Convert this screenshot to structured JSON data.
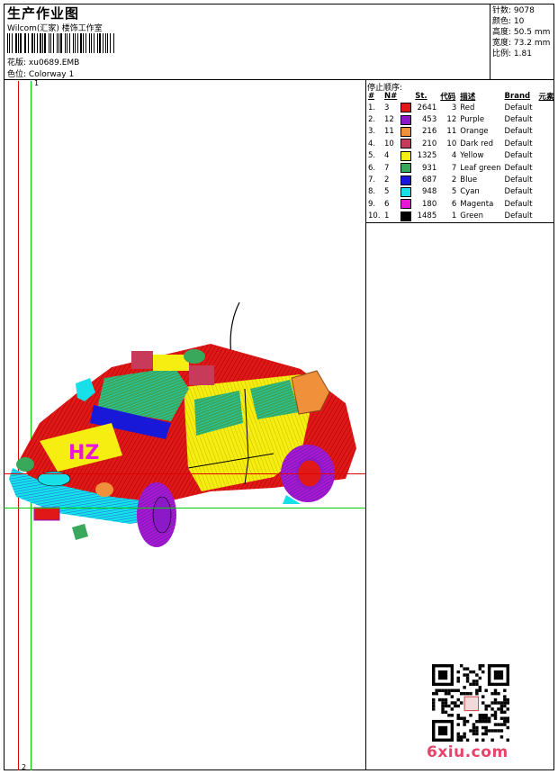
{
  "header": {
    "title": "生产作业图",
    "company": "Wilcom(汇家) 楼饰工作室",
    "design_label": "花版:",
    "design_value": "xu0689.EMB",
    "colorway_label": "色位:",
    "colorway_value": "Colorway 1"
  },
  "stats": [
    {
      "label": "针数:",
      "value": "9078"
    },
    {
      "label": "颜色:",
      "value": "10"
    },
    {
      "label": "高度:",
      "value": "50.5 mm"
    },
    {
      "label": "宽度:",
      "value": "73.2 mm"
    },
    {
      "label": "比例:",
      "value": "1.81"
    }
  ],
  "stop_sequence": {
    "title": "停止顺序:",
    "headers": {
      "order": "#",
      "needle": "N#",
      "stitches": "St.",
      "code": "代码",
      "desc": "描述",
      "brand": "Brand",
      "element": "元素"
    },
    "rows": [
      {
        "order": "1.",
        "needle": "3",
        "color": "#e01818",
        "stitches": "2641",
        "code": "3",
        "desc": "Red",
        "brand": "Default"
      },
      {
        "order": "2.",
        "needle": "12",
        "color": "#8b19c8",
        "stitches": "453",
        "code": "12",
        "desc": "Purple",
        "brand": "Default"
      },
      {
        "order": "3.",
        "needle": "11",
        "color": "#f0903a",
        "stitches": "216",
        "code": "11",
        "desc": "Orange",
        "brand": "Default"
      },
      {
        "order": "4.",
        "needle": "10",
        "color": "#c83a5a",
        "stitches": "210",
        "code": "10",
        "desc": "Dark red",
        "brand": "Default"
      },
      {
        "order": "5.",
        "needle": "4",
        "color": "#f5ee10",
        "stitches": "1325",
        "code": "4",
        "desc": "Yellow",
        "brand": "Default"
      },
      {
        "order": "6.",
        "needle": "7",
        "color": "#3aa85a",
        "stitches": "931",
        "code": "7",
        "desc": "Leaf green",
        "brand": "Default"
      },
      {
        "order": "7.",
        "needle": "2",
        "color": "#1818d8",
        "stitches": "687",
        "code": "2",
        "desc": "Blue",
        "brand": "Default"
      },
      {
        "order": "8.",
        "needle": "5",
        "color": "#18e0e8",
        "stitches": "948",
        "code": "5",
        "desc": "Cyan",
        "brand": "Default"
      },
      {
        "order": "9.",
        "needle": "6",
        "color": "#e818d8",
        "stitches": "180",
        "code": "6",
        "desc": "Magenta",
        "brand": "Default"
      },
      {
        "order": "10.",
        "needle": "1",
        "color": "#000000",
        "stitches": "1485",
        "code": "1",
        "desc": "Green",
        "brand": "Default"
      }
    ]
  },
  "guides": {
    "vertical_marker_top": "1",
    "vertical_marker_bottom": "2"
  },
  "car_badge": "HZ",
  "watermark": "6xiu.com",
  "colors": {
    "guide_red": "#e00000",
    "guide_green": "#00cc00",
    "watermark": "#e8436a"
  }
}
